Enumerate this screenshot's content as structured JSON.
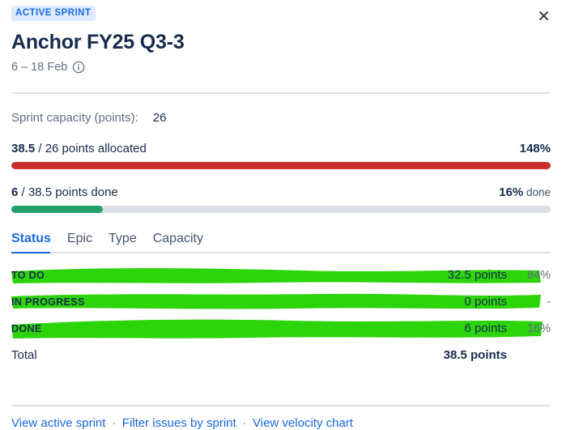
{
  "header": {
    "badge": "ACTIVE SPRINT",
    "title": "Anchor FY25 Q3-3",
    "dates": "6 – 18 Feb",
    "info_icon": "info-circle-icon",
    "close_icon": "close-icon"
  },
  "capacity": {
    "label": "Sprint capacity (points):",
    "value": "26"
  },
  "allocated": {
    "lead": "38.5",
    "rest": " / 26 points allocated",
    "percent": "148%",
    "percent_value": 148,
    "bar_fill_percent": 100,
    "bar_color": "#C9302C",
    "track_color": "#DCDFE4"
  },
  "done": {
    "lead": "6",
    "rest": " / 38.5 points done",
    "percent": "16%",
    "percent_suffix": " done",
    "percent_value": 16,
    "bar_fill_percent": 17,
    "bar_color": "#22A06B",
    "track_color": "#DCDFE4"
  },
  "tabs": [
    {
      "label": "Status",
      "active": true
    },
    {
      "label": "Epic",
      "active": false
    },
    {
      "label": "Type",
      "active": false
    },
    {
      "label": "Capacity",
      "active": false
    }
  ],
  "table": {
    "rows": [
      {
        "name": "TO DO",
        "points": "32.5 points",
        "percent": "84%",
        "highlighted": true
      },
      {
        "name": "IN PROGRESS",
        "points": "0 points",
        "percent": "-",
        "highlighted": true
      },
      {
        "name": "DONE",
        "points": "6 points",
        "percent": "16%",
        "highlighted": true
      }
    ],
    "total": {
      "name": "Total",
      "points": "38.5 points",
      "percent": ""
    }
  },
  "footer": {
    "links": [
      "View active sprint",
      "Filter issues by sprint",
      "View velocity chart"
    ],
    "separator": "·"
  },
  "colors": {
    "accent_blue": "#1868DB",
    "badge_bg": "#DEEBFF",
    "text_primary": "#172B4D",
    "text_muted": "#626F86",
    "highlighter_green": "#2CD40A",
    "red": "#C9302C",
    "green": "#22A06B"
  }
}
